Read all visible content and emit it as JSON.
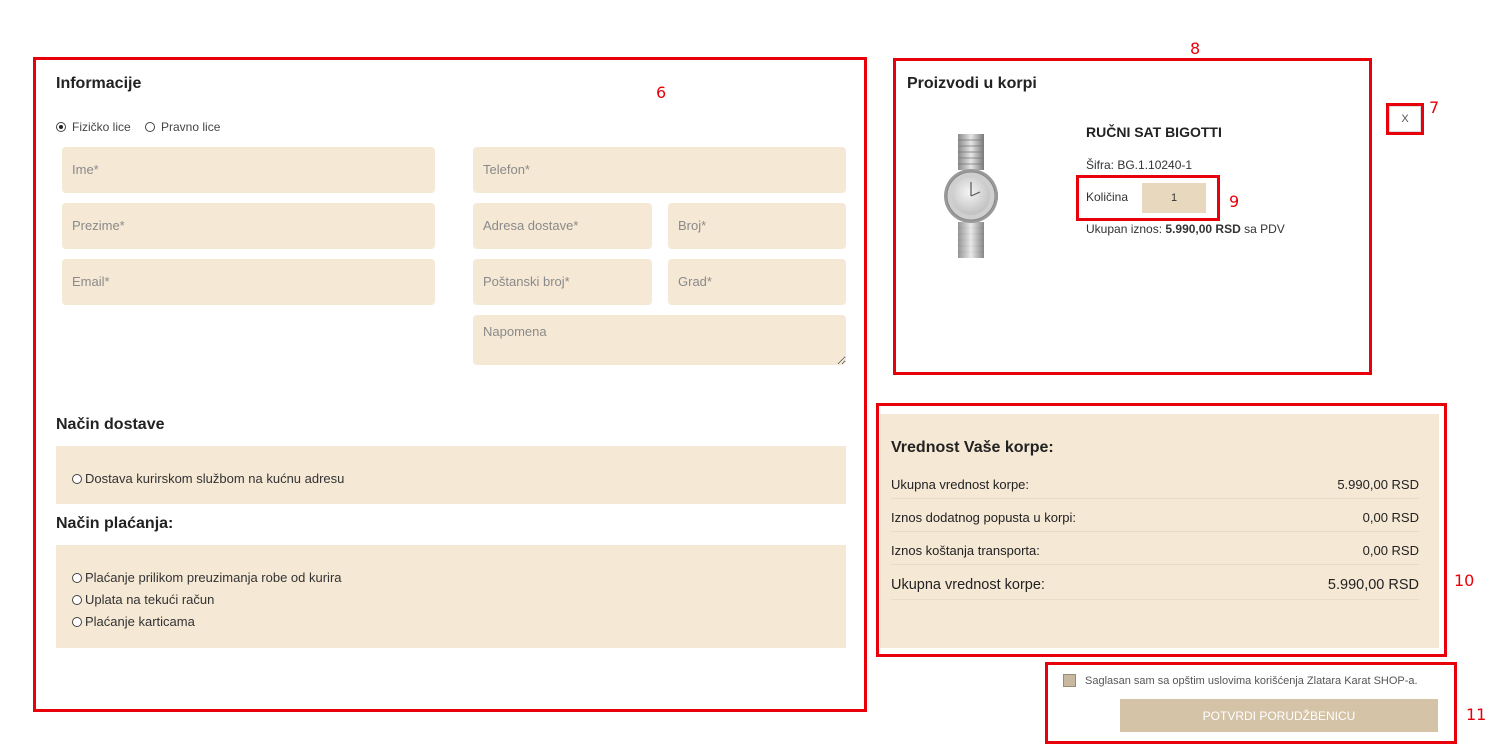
{
  "annotations": {
    "n6": "6",
    "n7": "7",
    "n8": "8",
    "n9": "9",
    "n10": "10",
    "n11": "11"
  },
  "info": {
    "title": "Informacije",
    "person_types": [
      "Fizičko lice",
      "Pravno lice"
    ],
    "selected_person_type": "Fizičko lice",
    "fields": {
      "first_name": "Ime*",
      "last_name": "Prezime*",
      "email": "Email*",
      "phone": "Telefon*",
      "address": "Adresa dostave*",
      "number": "Broj*",
      "postal": "Poštanski broj*",
      "city": "Grad*",
      "note": "Napomena"
    }
  },
  "delivery": {
    "title": "Način dostave",
    "options": [
      "Dostava kurirskom službom na kućnu adresu"
    ]
  },
  "payment": {
    "title": "Način plaćanja:",
    "options": [
      "Plaćanje prilikom preuzimanja robe od kurira",
      "Uplata na tekući račun",
      "Plaćanje karticama"
    ]
  },
  "cart": {
    "title": "Proizvodi u korpi",
    "remove_label": "X",
    "product": {
      "name": "RUČNI SAT BIGOTTI",
      "code": "Šifra: BG.1.10240-1",
      "qty_label": "Količina",
      "qty_value": "1",
      "total_prefix": "Ukupan iznos: ",
      "total_value": "5.990,00 RSD",
      "total_suffix": " sa PDV"
    }
  },
  "summary": {
    "title": "Vrednost Vaše korpe:",
    "rows": [
      {
        "label": "Ukupna vrednost korpe:",
        "value": "5.990,00 RSD"
      },
      {
        "label": "Iznos dodatnog popusta u korpi:",
        "value": "0,00 RSD"
      },
      {
        "label": "Iznos koštanja transporta:",
        "value": "0,00 RSD"
      },
      {
        "label": "Ukupna vrednost korpe:",
        "value": "5.990,00 RSD"
      }
    ]
  },
  "agreement": {
    "label": "Saglasan sam sa opštim uslovima korišćenja Zlatara Karat SHOP-a.",
    "submit": "POTVRDI PORUDŽBENICU"
  },
  "colors": {
    "accent_red": "#e8000b",
    "field_bg": "#f5e8d5",
    "button_bg": "#d4c3a6"
  }
}
